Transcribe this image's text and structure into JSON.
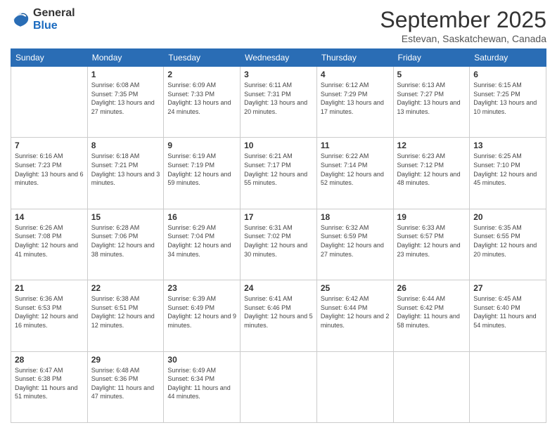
{
  "logo": {
    "general": "General",
    "blue": "Blue"
  },
  "header": {
    "month": "September 2025",
    "location": "Estevan, Saskatchewan, Canada"
  },
  "days_of_week": [
    "Sunday",
    "Monday",
    "Tuesday",
    "Wednesday",
    "Thursday",
    "Friday",
    "Saturday"
  ],
  "weeks": [
    [
      {
        "day": "",
        "sunrise": "",
        "sunset": "",
        "daylight": ""
      },
      {
        "day": "1",
        "sunrise": "Sunrise: 6:08 AM",
        "sunset": "Sunset: 7:35 PM",
        "daylight": "Daylight: 13 hours and 27 minutes."
      },
      {
        "day": "2",
        "sunrise": "Sunrise: 6:09 AM",
        "sunset": "Sunset: 7:33 PM",
        "daylight": "Daylight: 13 hours and 24 minutes."
      },
      {
        "day": "3",
        "sunrise": "Sunrise: 6:11 AM",
        "sunset": "Sunset: 7:31 PM",
        "daylight": "Daylight: 13 hours and 20 minutes."
      },
      {
        "day": "4",
        "sunrise": "Sunrise: 6:12 AM",
        "sunset": "Sunset: 7:29 PM",
        "daylight": "Daylight: 13 hours and 17 minutes."
      },
      {
        "day": "5",
        "sunrise": "Sunrise: 6:13 AM",
        "sunset": "Sunset: 7:27 PM",
        "daylight": "Daylight: 13 hours and 13 minutes."
      },
      {
        "day": "6",
        "sunrise": "Sunrise: 6:15 AM",
        "sunset": "Sunset: 7:25 PM",
        "daylight": "Daylight: 13 hours and 10 minutes."
      }
    ],
    [
      {
        "day": "7",
        "sunrise": "Sunrise: 6:16 AM",
        "sunset": "Sunset: 7:23 PM",
        "daylight": "Daylight: 13 hours and 6 minutes."
      },
      {
        "day": "8",
        "sunrise": "Sunrise: 6:18 AM",
        "sunset": "Sunset: 7:21 PM",
        "daylight": "Daylight: 13 hours and 3 minutes."
      },
      {
        "day": "9",
        "sunrise": "Sunrise: 6:19 AM",
        "sunset": "Sunset: 7:19 PM",
        "daylight": "Daylight: 12 hours and 59 minutes."
      },
      {
        "day": "10",
        "sunrise": "Sunrise: 6:21 AM",
        "sunset": "Sunset: 7:17 PM",
        "daylight": "Daylight: 12 hours and 55 minutes."
      },
      {
        "day": "11",
        "sunrise": "Sunrise: 6:22 AM",
        "sunset": "Sunset: 7:14 PM",
        "daylight": "Daylight: 12 hours and 52 minutes."
      },
      {
        "day": "12",
        "sunrise": "Sunrise: 6:23 AM",
        "sunset": "Sunset: 7:12 PM",
        "daylight": "Daylight: 12 hours and 48 minutes."
      },
      {
        "day": "13",
        "sunrise": "Sunrise: 6:25 AM",
        "sunset": "Sunset: 7:10 PM",
        "daylight": "Daylight: 12 hours and 45 minutes."
      }
    ],
    [
      {
        "day": "14",
        "sunrise": "Sunrise: 6:26 AM",
        "sunset": "Sunset: 7:08 PM",
        "daylight": "Daylight: 12 hours and 41 minutes."
      },
      {
        "day": "15",
        "sunrise": "Sunrise: 6:28 AM",
        "sunset": "Sunset: 7:06 PM",
        "daylight": "Daylight: 12 hours and 38 minutes."
      },
      {
        "day": "16",
        "sunrise": "Sunrise: 6:29 AM",
        "sunset": "Sunset: 7:04 PM",
        "daylight": "Daylight: 12 hours and 34 minutes."
      },
      {
        "day": "17",
        "sunrise": "Sunrise: 6:31 AM",
        "sunset": "Sunset: 7:02 PM",
        "daylight": "Daylight: 12 hours and 30 minutes."
      },
      {
        "day": "18",
        "sunrise": "Sunrise: 6:32 AM",
        "sunset": "Sunset: 6:59 PM",
        "daylight": "Daylight: 12 hours and 27 minutes."
      },
      {
        "day": "19",
        "sunrise": "Sunrise: 6:33 AM",
        "sunset": "Sunset: 6:57 PM",
        "daylight": "Daylight: 12 hours and 23 minutes."
      },
      {
        "day": "20",
        "sunrise": "Sunrise: 6:35 AM",
        "sunset": "Sunset: 6:55 PM",
        "daylight": "Daylight: 12 hours and 20 minutes."
      }
    ],
    [
      {
        "day": "21",
        "sunrise": "Sunrise: 6:36 AM",
        "sunset": "Sunset: 6:53 PM",
        "daylight": "Daylight: 12 hours and 16 minutes."
      },
      {
        "day": "22",
        "sunrise": "Sunrise: 6:38 AM",
        "sunset": "Sunset: 6:51 PM",
        "daylight": "Daylight: 12 hours and 12 minutes."
      },
      {
        "day": "23",
        "sunrise": "Sunrise: 6:39 AM",
        "sunset": "Sunset: 6:49 PM",
        "daylight": "Daylight: 12 hours and 9 minutes."
      },
      {
        "day": "24",
        "sunrise": "Sunrise: 6:41 AM",
        "sunset": "Sunset: 6:46 PM",
        "daylight": "Daylight: 12 hours and 5 minutes."
      },
      {
        "day": "25",
        "sunrise": "Sunrise: 6:42 AM",
        "sunset": "Sunset: 6:44 PM",
        "daylight": "Daylight: 12 hours and 2 minutes."
      },
      {
        "day": "26",
        "sunrise": "Sunrise: 6:44 AM",
        "sunset": "Sunset: 6:42 PM",
        "daylight": "Daylight: 11 hours and 58 minutes."
      },
      {
        "day": "27",
        "sunrise": "Sunrise: 6:45 AM",
        "sunset": "Sunset: 6:40 PM",
        "daylight": "Daylight: 11 hours and 54 minutes."
      }
    ],
    [
      {
        "day": "28",
        "sunrise": "Sunrise: 6:47 AM",
        "sunset": "Sunset: 6:38 PM",
        "daylight": "Daylight: 11 hours and 51 minutes."
      },
      {
        "day": "29",
        "sunrise": "Sunrise: 6:48 AM",
        "sunset": "Sunset: 6:36 PM",
        "daylight": "Daylight: 11 hours and 47 minutes."
      },
      {
        "day": "30",
        "sunrise": "Sunrise: 6:49 AM",
        "sunset": "Sunset: 6:34 PM",
        "daylight": "Daylight: 11 hours and 44 minutes."
      },
      {
        "day": "",
        "sunrise": "",
        "sunset": "",
        "daylight": ""
      },
      {
        "day": "",
        "sunrise": "",
        "sunset": "",
        "daylight": ""
      },
      {
        "day": "",
        "sunrise": "",
        "sunset": "",
        "daylight": ""
      },
      {
        "day": "",
        "sunrise": "",
        "sunset": "",
        "daylight": ""
      }
    ]
  ]
}
